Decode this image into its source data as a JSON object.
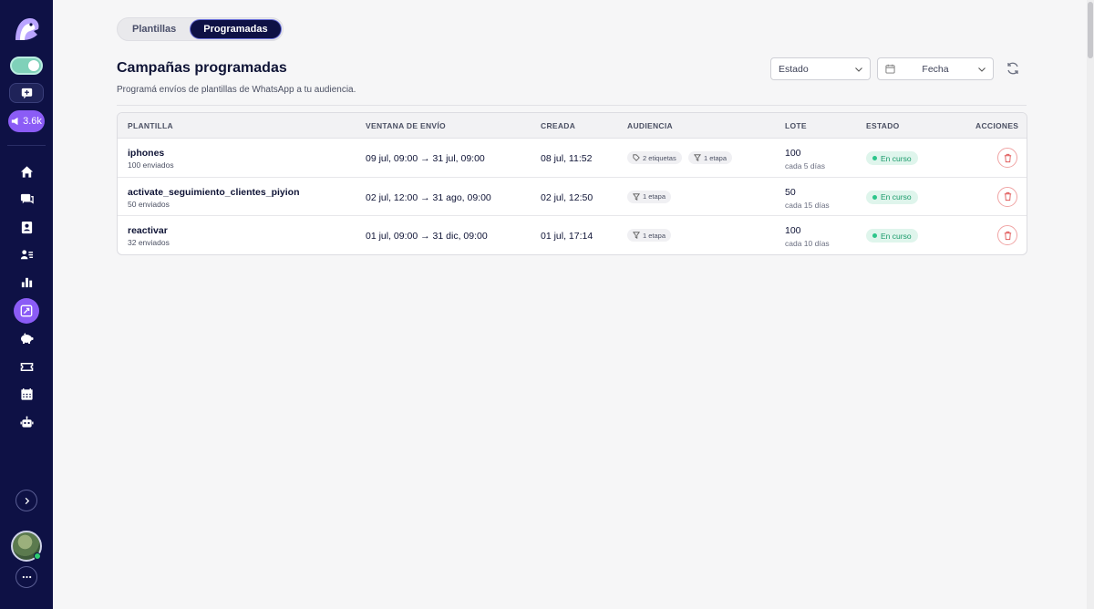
{
  "sidebar": {
    "audience_count": "3.6k",
    "nav": [
      {
        "name": "home-icon"
      },
      {
        "name": "chat-icon"
      },
      {
        "name": "contacts-icon"
      },
      {
        "name": "user-list-icon"
      },
      {
        "name": "bar-chart-icon"
      },
      {
        "name": "campaigns-icon",
        "active": true
      },
      {
        "name": "piggy-bank-icon"
      },
      {
        "name": "ticket-icon"
      },
      {
        "name": "calendar-icon"
      },
      {
        "name": "bot-icon"
      }
    ]
  },
  "tabs": [
    {
      "label": "Plantillas",
      "active": false
    },
    {
      "label": "Programadas",
      "active": true
    }
  ],
  "header": {
    "title": "Campañas programadas",
    "subtitle": "Programá envíos de plantillas de WhatsApp a tu audiencia."
  },
  "filters": {
    "estado_label": "Estado",
    "fecha_label": "Fecha"
  },
  "table": {
    "columns": [
      "PLANTILLA",
      "VENTANA DE ENVÍO",
      "CREADA",
      "AUDIENCIA",
      "LOTE",
      "ESTADO",
      "ACCIONES"
    ],
    "rows": [
      {
        "name": "iphones",
        "sent": "100 enviados",
        "window": "09 jul, 09:00 → 31 jul, 09:00",
        "created": "08 jul, 11:52",
        "tags": "2 etiquetas",
        "stage": "1 etapa",
        "lote": "100",
        "lote_sub": "cada 5 días",
        "status": "En curso"
      },
      {
        "name": "activate_seguimiento_clientes_piyion",
        "sent": "50 enviados",
        "window": "02 jul, 12:00 → 31 ago, 09:00",
        "created": "02 jul, 12:50",
        "tags": "",
        "stage": "1 etapa",
        "lote": "50",
        "lote_sub": "cada 15 días",
        "status": "En curso"
      },
      {
        "name": "reactivar",
        "sent": "32 enviados",
        "window": "01 jul, 09:00 → 31 dic, 09:00",
        "created": "01 jul, 17:14",
        "tags": "",
        "stage": "1 etapa",
        "lote": "100",
        "lote_sub": "cada 10 días",
        "status": "En curso"
      }
    ]
  },
  "colors": {
    "sidebar_bg": "#0e1145",
    "accent": "#8b5cf6",
    "status_bg": "#dff5ec",
    "status_text": "#1a9a6a",
    "danger": "#e05a5a"
  }
}
